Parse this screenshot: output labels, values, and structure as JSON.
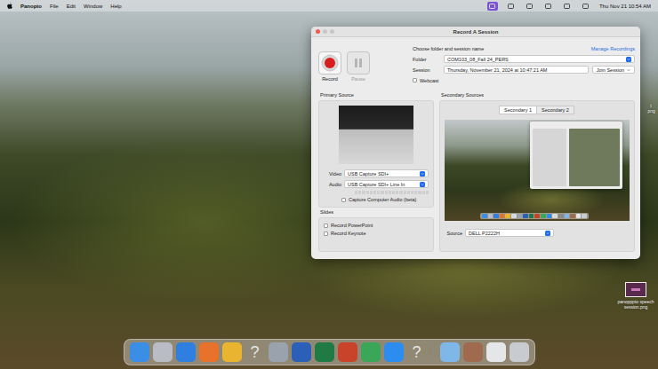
{
  "menubar": {
    "app": "Panopto",
    "items": [
      "File",
      "Edit",
      "Window",
      "Help"
    ],
    "clock": "Thu Nov 21  10:54 AM",
    "status_icons": [
      {
        "selected": true
      },
      {
        "selected": false
      },
      {
        "selected": false
      },
      {
        "selected": false
      },
      {
        "selected": false
      },
      {
        "selected": false
      }
    ]
  },
  "window": {
    "title": "Record A Session"
  },
  "controls": [
    {
      "label": "Record",
      "disabled": false
    },
    {
      "label": "Pause",
      "disabled": true
    }
  ],
  "session_form": {
    "heading": "Choose folder and session name",
    "manage_link": "Manage Recordings",
    "folder_label": "Folder",
    "folder": "COM103_08_Fall 24_PERS",
    "session_label": "Session",
    "session": "Thursday, November 21, 2024 at 10:47:21 AM",
    "join_button": "Join Session",
    "webcast": {
      "label": "Webcast",
      "checked": false
    }
  },
  "primary_source": {
    "title": "Primary Source",
    "video_label": "Video",
    "video": "USB Capture SDI+",
    "audio_label": "Audio",
    "audio": "USB Capture SDI+ Line In",
    "audio_level": 0,
    "capture_computer_audio": {
      "label": "Capture Computer Audio (beta)",
      "checked": false
    }
  },
  "slides": {
    "title": "Slides",
    "options": [
      {
        "label": "Record PowerPoint",
        "checked": false
      },
      {
        "label": "Record Keynote",
        "checked": false
      }
    ]
  },
  "secondary_sources": {
    "title": "Secondary Sources",
    "tabs": [
      {
        "label": "Secondary 1",
        "selected": true
      },
      {
        "label": "Secondary 2",
        "selected": false
      }
    ],
    "source_label": "Source",
    "source": "DELL P2222H"
  },
  "desktop_files": [
    {
      "lines": [
        "t",
        ".png"
      ]
    },
    {
      "lines": [
        "panopppto speech",
        "session.png"
      ]
    }
  ],
  "dock": [
    {
      "kind": "app",
      "glyph": "",
      "color": "#3a8ee6"
    },
    {
      "kind": "app",
      "glyph": "",
      "color": "#b9bcc4"
    },
    {
      "kind": "app",
      "glyph": "",
      "color": "#2f7fe0"
    },
    {
      "kind": "app",
      "glyph": "",
      "color": "#e8712b"
    },
    {
      "kind": "app",
      "glyph": "",
      "color": "#e9b530"
    },
    {
      "kind": "missing",
      "glyph": "?",
      "color": "#d9dadc"
    },
    {
      "kind": "app",
      "glyph": "",
      "color": "#9aa3ad"
    },
    {
      "kind": "app",
      "glyph": "",
      "color": "#2b5fb8"
    },
    {
      "kind": "app",
      "glyph": "",
      "color": "#1f7a43"
    },
    {
      "kind": "app",
      "glyph": "",
      "color": "#c9432a"
    },
    {
      "kind": "app",
      "glyph": "",
      "color": "#3aa657"
    },
    {
      "kind": "app",
      "glyph": "",
      "color": "#2d8cf0"
    },
    {
      "kind": "missing",
      "glyph": "?",
      "color": "#d9dadc"
    },
    {
      "kind": "separator",
      "glyph": "",
      "color": "#8a8a8a"
    },
    {
      "kind": "app",
      "glyph": "",
      "color": "#7fb7e8"
    },
    {
      "kind": "app",
      "glyph": "",
      "color": "#a06a4e"
    },
    {
      "kind": "app",
      "glyph": "",
      "color": "#e4e6e8"
    },
    {
      "kind": "app",
      "glyph": "",
      "color": "#c8ccd0"
    }
  ]
}
